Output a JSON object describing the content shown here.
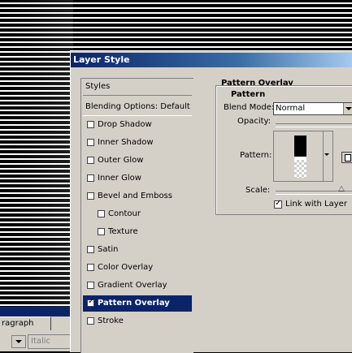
{
  "dialog": {
    "title": "Layer Style"
  },
  "styles_panel": {
    "header": "Styles",
    "items": [
      {
        "label": "Blending Options: Default",
        "checkbox": false,
        "checked": false,
        "indent": false,
        "selected": false
      },
      {
        "label": "Drop Shadow",
        "checkbox": true,
        "checked": false,
        "indent": false,
        "selected": false
      },
      {
        "label": "Inner Shadow",
        "checkbox": true,
        "checked": false,
        "indent": false,
        "selected": false
      },
      {
        "label": "Outer Glow",
        "checkbox": true,
        "checked": false,
        "indent": false,
        "selected": false
      },
      {
        "label": "Inner Glow",
        "checkbox": true,
        "checked": false,
        "indent": false,
        "selected": false
      },
      {
        "label": "Bevel and Emboss",
        "checkbox": true,
        "checked": false,
        "indent": false,
        "selected": false
      },
      {
        "label": "Contour",
        "checkbox": true,
        "checked": false,
        "indent": true,
        "selected": false
      },
      {
        "label": "Texture",
        "checkbox": true,
        "checked": false,
        "indent": true,
        "selected": false
      },
      {
        "label": "Satin",
        "checkbox": true,
        "checked": false,
        "indent": false,
        "selected": false
      },
      {
        "label": "Color Overlay",
        "checkbox": true,
        "checked": false,
        "indent": false,
        "selected": false
      },
      {
        "label": "Gradient Overlay",
        "checkbox": true,
        "checked": false,
        "indent": false,
        "selected": false
      },
      {
        "label": "Pattern Overlay",
        "checkbox": true,
        "checked": true,
        "indent": false,
        "selected": true
      },
      {
        "label": "Stroke",
        "checkbox": true,
        "checked": false,
        "indent": false,
        "selected": false
      }
    ]
  },
  "pattern_overlay": {
    "section_title": "Pattern Overlay",
    "group_title": "Pattern",
    "blend_mode_label": "Blend Mode:",
    "blend_mode_value": "Normal",
    "opacity_label": "Opacity:",
    "pattern_label": "Pattern:",
    "scale_label": "Scale:",
    "link_label": "Link with Layer",
    "link_checked": true,
    "scale_level": 0.85
  },
  "background_panel": {
    "tab_label": "ragraph",
    "style_field": "Italic"
  },
  "colors": {
    "selection": "#0a246a",
    "dialog_bg": "#d4d0c8",
    "title_gradient_start": "#0a246a",
    "title_gradient_end": "#a6caf0"
  },
  "icons": {
    "checkbox_checked": "check-icon",
    "dropdown": "chevron-down-icon",
    "new_pattern": "new-pattern-icon"
  }
}
